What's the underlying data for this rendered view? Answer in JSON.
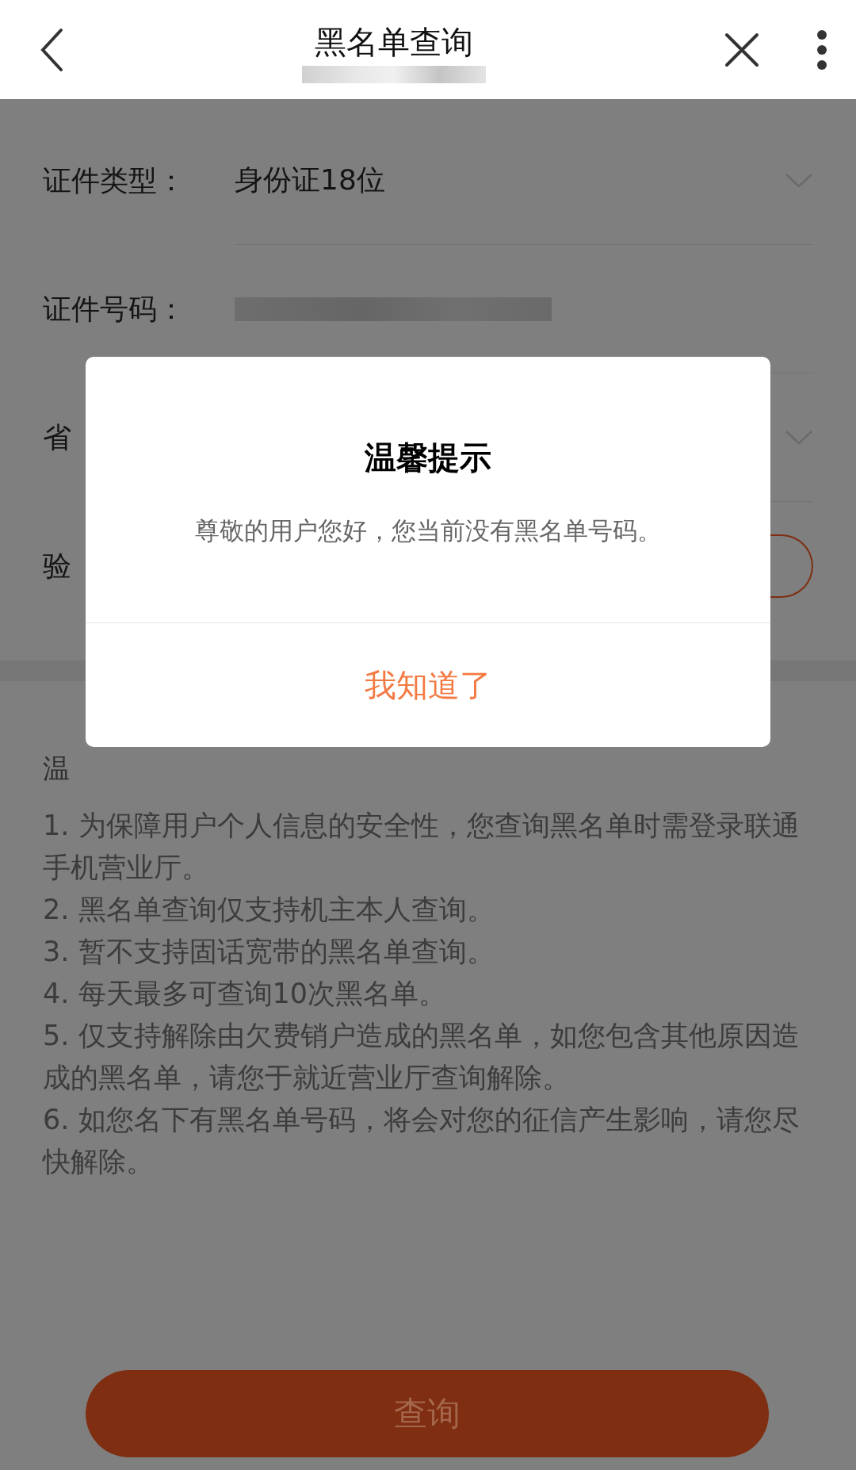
{
  "header": {
    "title": "黑名单查询"
  },
  "form": {
    "rows": [
      {
        "kind": "select",
        "label": "证件类型：",
        "value": "身份证18位"
      },
      {
        "kind": "redacted",
        "label": "证件号码："
      },
      {
        "kind": "select",
        "label": "省"
      },
      {
        "kind": "code",
        "label": "验"
      }
    ]
  },
  "notes": {
    "heading": "温",
    "items": [
      "1. 为保障用户个人信息的安全性，您查询黑名单时需登录联通手机营业厅。",
      "2. 黑名单查询仅支持机主本人查询。",
      "3. 暂不支持固话宽带的黑名单查询。",
      "4. 每天最多可查询10次黑名单。",
      "5. 仅支持解除由欠费销户造成的黑名单，如您包含其他原因造成的黑名单，请您于就近营业厅查询解除。",
      "6. 如您名下有黑名单号码，将会对您的征信产生影响，请您尽快解除。"
    ]
  },
  "submit_button": "查询",
  "dialog": {
    "title": "温馨提示",
    "message": "尊敬的用户您好，您当前没有黑名单号码。",
    "button": "我知道了"
  }
}
